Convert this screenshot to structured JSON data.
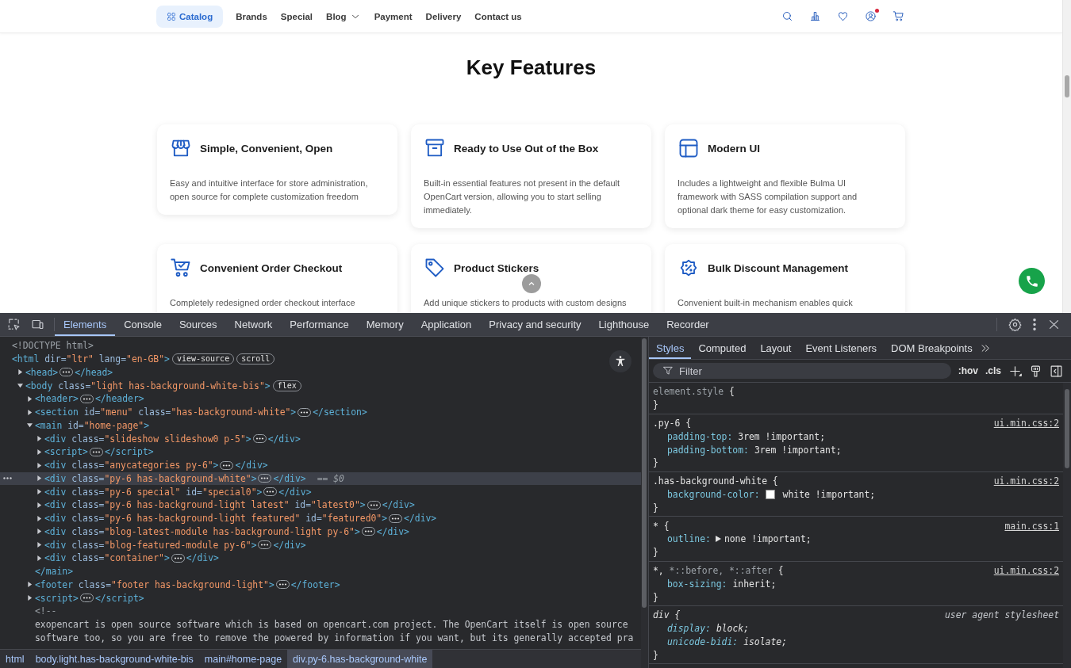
{
  "site": {
    "nav": [
      {
        "label": "Catalog",
        "kind": "catalog",
        "selected": true
      },
      {
        "label": "Brands",
        "kind": "link",
        "selected": false
      },
      {
        "label": "Special",
        "kind": "link",
        "selected": false
      },
      {
        "label": "Blog",
        "kind": "dropdown",
        "selected": false
      },
      {
        "label": "Payment",
        "kind": "link",
        "selected": false
      },
      {
        "label": "Delivery",
        "kind": "link",
        "selected": false
      },
      {
        "label": "Contact us",
        "kind": "link",
        "selected": false
      }
    ],
    "heading": "Key Features",
    "features": [
      {
        "kind": "store",
        "title": "Simple, Convenient, Open",
        "description": "Easy and intuitive interface for store administration, open source for complete customization freedom"
      },
      {
        "kind": "box",
        "title": "Ready to Use Out of the Box",
        "description": "Built-in essential features not present in the default OpenCart version, allowing you to start selling immediately."
      },
      {
        "kind": "layout",
        "title": "Modern UI",
        "description": "Includes a lightweight and flexible Bulma UI framework with SASS compilation support and optional dark theme for easy customization."
      },
      {
        "kind": "cart",
        "title": "Convenient Order Checkout",
        "description": "Completely redesigned order checkout interface"
      },
      {
        "kind": "tag",
        "title": "Product Stickers",
        "description": "Add unique stickers to products with custom designs"
      },
      {
        "kind": "discount",
        "title": "Bulk Discount Management",
        "description": "Convenient built-in mechanism enables quick"
      }
    ]
  },
  "devtools": {
    "tabs": [
      {
        "label": "Elements",
        "selected": true
      },
      {
        "label": "Console",
        "selected": false
      },
      {
        "label": "Sources",
        "selected": false
      },
      {
        "label": "Network",
        "selected": false
      },
      {
        "label": "Performance",
        "selected": false
      },
      {
        "label": "Memory",
        "selected": false
      },
      {
        "label": "Application",
        "selected": false
      },
      {
        "label": "Privacy and security",
        "selected": false
      },
      {
        "label": "Lighthouse",
        "selected": false
      },
      {
        "label": "Recorder",
        "selected": false
      }
    ],
    "dom_tree": [
      {
        "selected": false,
        "parts": [
          {
            "kind": "doctype",
            "text": "<!DOCTYPE html>"
          }
        ]
      },
      {
        "selected": false,
        "parts": [
          {
            "kind": "tag",
            "text": "<html"
          },
          {
            "kind": "attr",
            "text": " dir="
          },
          {
            "kind": "value",
            "text": "\"ltr\""
          },
          {
            "kind": "attr",
            "text": " lang="
          },
          {
            "kind": "value",
            "text": "\"en-GB\""
          },
          {
            "kind": "tag",
            "text": ">"
          },
          {
            "kind": "badge",
            "text": "view-source"
          },
          {
            "kind": "badge",
            "text": "scroll"
          }
        ],
        "children": [
          {
            "selected": false,
            "expanded": false,
            "parts": [
              {
                "kind": "tag",
                "text": "<head>"
              },
              {
                "kind": "dots"
              },
              {
                "kind": "tag",
                "text": "</head>"
              }
            ]
          },
          {
            "selected": false,
            "expanded": true,
            "parts": [
              {
                "kind": "tag",
                "text": "<body"
              },
              {
                "kind": "attr",
                "text": " class="
              },
              {
                "kind": "value",
                "text": "\"light has-background-white-bis\""
              },
              {
                "kind": "tag",
                "text": ">"
              },
              {
                "kind": "badge",
                "text": "flex"
              }
            ],
            "children": [
              {
                "selected": false,
                "expanded": false,
                "parts": [
                  {
                    "kind": "tag",
                    "text": "<header>"
                  },
                  {
                    "kind": "dots"
                  },
                  {
                    "kind": "tag",
                    "text": "</header>"
                  }
                ]
              },
              {
                "selected": false,
                "expanded": false,
                "parts": [
                  {
                    "kind": "tag",
                    "text": "<section"
                  },
                  {
                    "kind": "attr",
                    "text": " id="
                  },
                  {
                    "kind": "value",
                    "text": "\"menu\""
                  },
                  {
                    "kind": "attr",
                    "text": " class="
                  },
                  {
                    "kind": "value",
                    "text": "\"has-background-white\""
                  },
                  {
                    "kind": "tag",
                    "text": ">"
                  },
                  {
                    "kind": "dots"
                  },
                  {
                    "kind": "tag",
                    "text": "</section>"
                  }
                ]
              },
              {
                "selected": false,
                "expanded": true,
                "parts": [
                  {
                    "kind": "tag",
                    "text": "<main"
                  },
                  {
                    "kind": "attr",
                    "text": " id="
                  },
                  {
                    "kind": "value",
                    "text": "\"home-page\""
                  },
                  {
                    "kind": "tag",
                    "text": ">"
                  }
                ],
                "closing": "</main>",
                "children": [
                  {
                    "selected": false,
                    "expanded": false,
                    "parts": [
                      {
                        "kind": "tag",
                        "text": "<div"
                      },
                      {
                        "kind": "attr",
                        "text": " class="
                      },
                      {
                        "kind": "value",
                        "text": "\"slideshow slideshow0 p-5\""
                      },
                      {
                        "kind": "tag",
                        "text": ">"
                      },
                      {
                        "kind": "dots"
                      },
                      {
                        "kind": "tag",
                        "text": "</div>"
                      }
                    ]
                  },
                  {
                    "selected": false,
                    "expanded": false,
                    "parts": [
                      {
                        "kind": "tag",
                        "text": "<script>"
                      },
                      {
                        "kind": "dots"
                      },
                      {
                        "kind": "tag",
                        "text": "</script>"
                      }
                    ]
                  },
                  {
                    "selected": false,
                    "expanded": false,
                    "parts": [
                      {
                        "kind": "tag",
                        "text": "<div"
                      },
                      {
                        "kind": "attr",
                        "text": " class="
                      },
                      {
                        "kind": "value",
                        "text": "\"anycategories py-6\""
                      },
                      {
                        "kind": "tag",
                        "text": ">"
                      },
                      {
                        "kind": "dots"
                      },
                      {
                        "kind": "tag",
                        "text": "</div>"
                      }
                    ]
                  },
                  {
                    "selected": true,
                    "expanded": false,
                    "parts": [
                      {
                        "kind": "tag",
                        "text": "<div"
                      },
                      {
                        "kind": "attr",
                        "text": " class="
                      },
                      {
                        "kind": "value",
                        "text": "\"py-6 has-background-white\""
                      },
                      {
                        "kind": "tag",
                        "text": ">"
                      },
                      {
                        "kind": "dots"
                      },
                      {
                        "kind": "tag",
                        "text": "</div>"
                      },
                      {
                        "kind": "marker",
                        "text": "== $0"
                      }
                    ]
                  },
                  {
                    "selected": false,
                    "expanded": false,
                    "parts": [
                      {
                        "kind": "tag",
                        "text": "<div"
                      },
                      {
                        "kind": "attr",
                        "text": " class="
                      },
                      {
                        "kind": "value",
                        "text": "\"py-6 special\""
                      },
                      {
                        "kind": "attr",
                        "text": " id="
                      },
                      {
                        "kind": "value",
                        "text": "\"special0\""
                      },
                      {
                        "kind": "tag",
                        "text": ">"
                      },
                      {
                        "kind": "dots"
                      },
                      {
                        "kind": "tag",
                        "text": "</div>"
                      }
                    ]
                  },
                  {
                    "selected": false,
                    "expanded": false,
                    "parts": [
                      {
                        "kind": "tag",
                        "text": "<div"
                      },
                      {
                        "kind": "attr",
                        "text": " class="
                      },
                      {
                        "kind": "value",
                        "text": "\"py-6 has-background-light latest\""
                      },
                      {
                        "kind": "attr",
                        "text": " id="
                      },
                      {
                        "kind": "value",
                        "text": "\"latest0\""
                      },
                      {
                        "kind": "tag",
                        "text": ">"
                      },
                      {
                        "kind": "dots"
                      },
                      {
                        "kind": "tag",
                        "text": "</div>"
                      }
                    ]
                  },
                  {
                    "selected": false,
                    "expanded": false,
                    "parts": [
                      {
                        "kind": "tag",
                        "text": "<div"
                      },
                      {
                        "kind": "attr",
                        "text": " class="
                      },
                      {
                        "kind": "value",
                        "text": "\"py-6 has-background-light featured\""
                      },
                      {
                        "kind": "attr",
                        "text": " id="
                      },
                      {
                        "kind": "value",
                        "text": "\"featured0\""
                      },
                      {
                        "kind": "tag",
                        "text": ">"
                      },
                      {
                        "kind": "dots"
                      },
                      {
                        "kind": "tag",
                        "text": "</div>"
                      }
                    ]
                  },
                  {
                    "selected": false,
                    "expanded": false,
                    "parts": [
                      {
                        "kind": "tag",
                        "text": "<div"
                      },
                      {
                        "kind": "attr",
                        "text": " class="
                      },
                      {
                        "kind": "value",
                        "text": "\"blog-latest-module has-background-light py-6\""
                      },
                      {
                        "kind": "tag",
                        "text": ">"
                      },
                      {
                        "kind": "dots"
                      },
                      {
                        "kind": "tag",
                        "text": "</div>"
                      }
                    ]
                  },
                  {
                    "selected": false,
                    "expanded": false,
                    "parts": [
                      {
                        "kind": "tag",
                        "text": "<div"
                      },
                      {
                        "kind": "attr",
                        "text": " class="
                      },
                      {
                        "kind": "value",
                        "text": "\"blog-featured-module py-6\""
                      },
                      {
                        "kind": "tag",
                        "text": ">"
                      },
                      {
                        "kind": "dots"
                      },
                      {
                        "kind": "tag",
                        "text": "</div>"
                      }
                    ]
                  },
                  {
                    "selected": false,
                    "expanded": false,
                    "parts": [
                      {
                        "kind": "tag",
                        "text": "<div"
                      },
                      {
                        "kind": "attr",
                        "text": " class="
                      },
                      {
                        "kind": "value",
                        "text": "\"container\""
                      },
                      {
                        "kind": "tag",
                        "text": ">"
                      },
                      {
                        "kind": "dots"
                      },
                      {
                        "kind": "tag",
                        "text": "</div>"
                      }
                    ]
                  }
                ]
              },
              {
                "selected": false,
                "expanded": false,
                "parts": [
                  {
                    "kind": "tag",
                    "text": "<footer"
                  },
                  {
                    "kind": "attr",
                    "text": " class="
                  },
                  {
                    "kind": "value",
                    "text": "\"footer has-background-light\""
                  },
                  {
                    "kind": "tag",
                    "text": ">"
                  },
                  {
                    "kind": "dots"
                  },
                  {
                    "kind": "tag",
                    "text": "</footer>"
                  }
                ]
              },
              {
                "selected": false,
                "expanded": false,
                "parts": [
                  {
                    "kind": "tag",
                    "text": "<script>"
                  },
                  {
                    "kind": "dots"
                  },
                  {
                    "kind": "tag",
                    "text": "</script>"
                  }
                ]
              },
              {
                "selected": false,
                "parts": [
                  {
                    "kind": "doctype",
                    "text": "<!--"
                  }
                ]
              },
              {
                "selected": false,
                "parts": [
                  {
                    "kind": "comment",
                    "text": "exopencart is open source software which is based on opencart.com project. The OpenCart itself is open source"
                  }
                ]
              },
              {
                "selected": false,
                "parts": [
                  {
                    "kind": "comment",
                    "text": "software too, so you are free to remove the powered by information if you want, but its generally accepted pra"
                  }
                ]
              }
            ]
          }
        ]
      }
    ],
    "breadcrumbs": [
      {
        "label": "html",
        "selected": false
      },
      {
        "label": "body.light.has-background-white-bis",
        "selected": false
      },
      {
        "label": "main#home-page",
        "selected": false
      },
      {
        "label": "div.py-6.has-background-white",
        "selected": true
      }
    ],
    "sidebar_tabs": [
      {
        "label": "Styles",
        "selected": true
      },
      {
        "label": "Computed",
        "selected": false
      },
      {
        "label": "Layout",
        "selected": false
      },
      {
        "label": "Event Listeners",
        "selected": false
      },
      {
        "label": "DOM Breakpoints",
        "selected": false
      }
    ],
    "filter": {
      "placeholder": "Filter"
    },
    "toggles": [
      ":hov",
      ".cls"
    ],
    "rules": [
      {
        "selector": [
          {
            "text": "element.style",
            "dimmed": true
          },
          {
            "text": " {",
            "dimmed": false
          }
        ],
        "close": "}"
      },
      {
        "selector": [
          {
            "text": ".py-6 {",
            "dimmed": false
          }
        ],
        "source": {
          "text": "ui.min.css:2",
          "link": true
        },
        "declarations": [
          {
            "property": "padding-top:",
            "value": "3rem !important;"
          },
          {
            "property": "padding-bottom:",
            "value": "3rem !important;"
          }
        ],
        "close": "}"
      },
      {
        "selector": [
          {
            "text": ".has-background-white {",
            "dimmed": false
          }
        ],
        "source": {
          "text": "ui.min.css:2",
          "link": true
        },
        "declarations": [
          {
            "property": "background-color:",
            "color": "#ffffff",
            "value": "white !important;"
          }
        ],
        "close": "}"
      },
      {
        "selector": [
          {
            "text": "* {",
            "dimmed": false
          }
        ],
        "source": {
          "text": "main.css:1",
          "link": true
        },
        "declarations": [
          {
            "property": "outline:",
            "expandable": true,
            "value": "none !important;"
          }
        ],
        "close": "}"
      },
      {
        "selector": [
          {
            "text": "*,",
            "dimmed": false
          },
          {
            "text": " *::before, *::after",
            "dimmed": true
          },
          {
            "text": " {",
            "dimmed": false
          }
        ],
        "source": {
          "text": "ui.min.css:2",
          "link": true
        },
        "declarations": [
          {
            "property": "box-sizing:",
            "value": "inherit;"
          }
        ],
        "close": "}"
      },
      {
        "selector": [
          {
            "text": "div {",
            "dimmed": false
          }
        ],
        "user_agent": true,
        "source": {
          "text": "user agent stylesheet",
          "link": false
        },
        "declarations": [
          {
            "property": "display:",
            "value": "block;"
          },
          {
            "property": "unicode-bidi:",
            "value": "isolate;"
          }
        ],
        "close": "}"
      }
    ]
  }
}
